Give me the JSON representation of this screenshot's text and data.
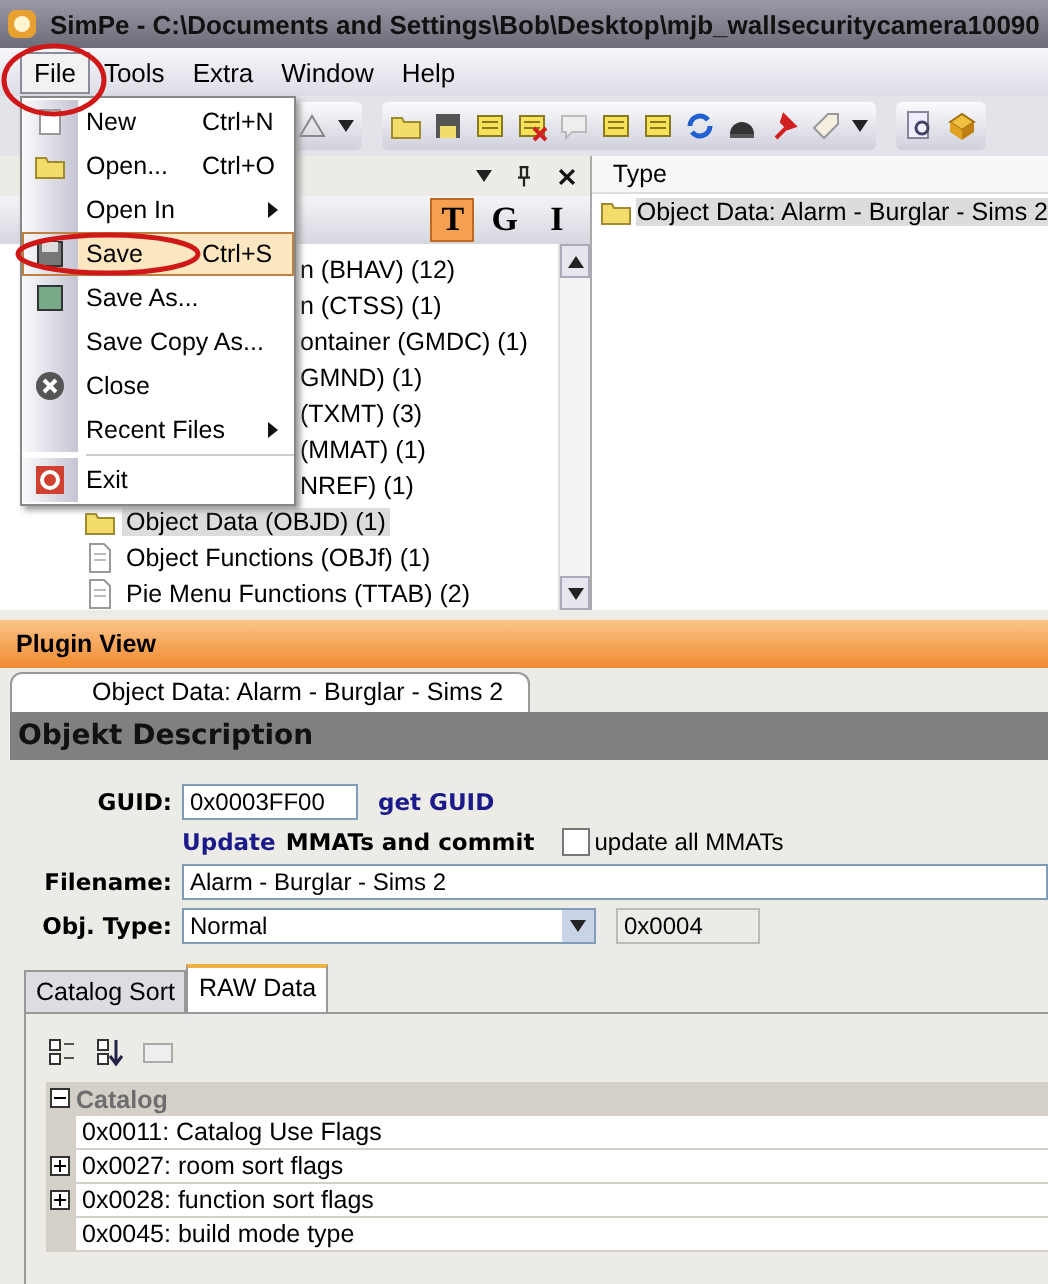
{
  "window": {
    "title": "SimPe - C:\\Documents and Settings\\Bob\\Desktop\\mjb_wallsecuritycamera10090"
  },
  "menu_bar": [
    {
      "label": "File",
      "selected": true
    },
    {
      "label": "Tools",
      "selected": false
    },
    {
      "label": "Extra",
      "selected": false
    },
    {
      "label": "Window",
      "selected": false
    },
    {
      "label": "Help",
      "selected": false
    }
  ],
  "file_menu": [
    {
      "kind": "item",
      "label": "New",
      "shortcut": "Ctrl+N",
      "selected": false
    },
    {
      "kind": "item",
      "label": "Open...",
      "shortcut": "Ctrl+O",
      "selected": false
    },
    {
      "kind": "submenu",
      "label": "Open In",
      "selected": false
    },
    {
      "kind": "item",
      "label": "Save",
      "shortcut": "Ctrl+S",
      "selected": true
    },
    {
      "kind": "item",
      "label": "Save As...",
      "selected": false
    },
    {
      "kind": "item",
      "label": "Save Copy As...",
      "selected": false
    },
    {
      "kind": "item",
      "label": "Close",
      "selected": false
    },
    {
      "kind": "submenu",
      "label": "Recent Files",
      "selected": false
    },
    {
      "kind": "separator"
    },
    {
      "kind": "item",
      "label": "Exit",
      "selected": false
    }
  ],
  "view_tabs": [
    {
      "label": "T",
      "selected": true
    },
    {
      "label": "G",
      "selected": false
    },
    {
      "label": "I",
      "selected": false
    }
  ],
  "tree": [
    {
      "kind": "cut",
      "label": "n (BHAV) (12)",
      "selected": false
    },
    {
      "kind": "cut",
      "label": "n (CTSS) (1)",
      "selected": false
    },
    {
      "kind": "cut",
      "label": "ontainer (GMDC) (1)",
      "selected": false
    },
    {
      "kind": "cut",
      "label": "GMND) (1)",
      "selected": false
    },
    {
      "kind": "cut",
      "label": "(TXMT) (3)",
      "selected": false
    },
    {
      "kind": "cut",
      "label": "(MMAT) (1)",
      "selected": false
    },
    {
      "kind": "cut",
      "label": "NREF) (1)",
      "selected": false
    },
    {
      "kind": "folder",
      "label": "Object Data (OBJD) (1)",
      "selected": true
    },
    {
      "kind": "file",
      "label": "Object Functions (OBJf) (1)",
      "selected": false
    },
    {
      "kind": "file",
      "label": "Pie Menu Functions (TTAB) (2)",
      "selected": false
    }
  ],
  "resource_list": {
    "columns": [
      "Type"
    ],
    "rows": [
      {
        "label": "Object Data: Alarm - Burglar - Sims 2",
        "selected": true
      }
    ]
  },
  "plugin_view": {
    "title": "Plugin View",
    "tabs": [
      {
        "label": "Object Data: Alarm - Burglar - Sims 2",
        "selected": true
      }
    ],
    "section_title": "Objekt Description",
    "guid": {
      "label": "GUID:",
      "value": "0x0003FF00",
      "link": "get GUID"
    },
    "update": {
      "link": "Update",
      "text": "MMATs and commit"
    },
    "update_all": {
      "label": "update all MMATs",
      "checked": false
    },
    "filename": {
      "label": "Filename:",
      "value": "Alarm - Burglar - Sims 2"
    },
    "obj_type": {
      "label": "Obj. Type:",
      "value": "Normal",
      "code": "0x0004"
    },
    "subtabs": [
      {
        "label": "Catalog Sort",
        "selected": false
      },
      {
        "label": "RAW Data",
        "selected": true
      }
    ],
    "grid": {
      "category": "Catalog",
      "expanded": true,
      "rows": [
        {
          "label": "0x0011: Catalog Use Flags",
          "expandable": false
        },
        {
          "label": "0x0027: room sort flags",
          "expandable": true
        },
        {
          "label": "0x0028: function sort flags",
          "expandable": true
        },
        {
          "label": "0x0045: build mode type",
          "expandable": false
        }
      ]
    }
  }
}
